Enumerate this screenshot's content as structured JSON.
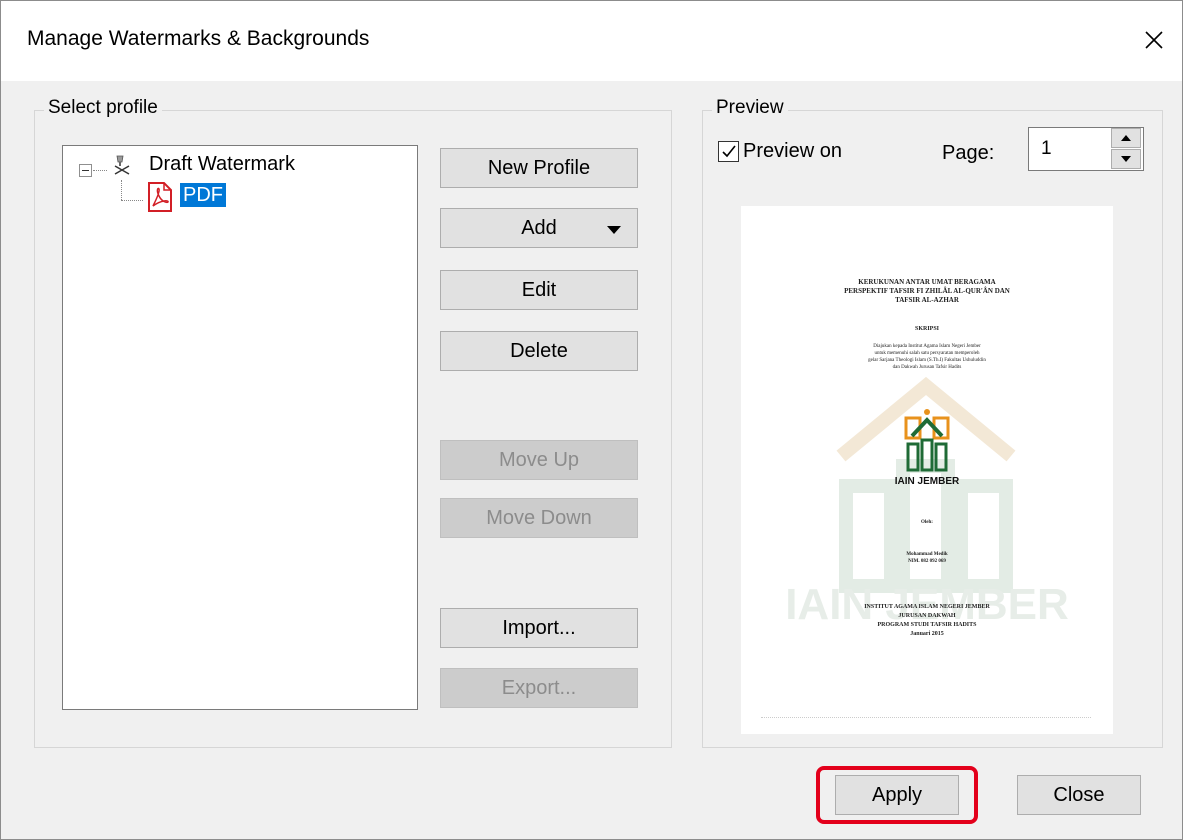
{
  "window": {
    "title": "Manage Watermarks & Backgrounds"
  },
  "select_profile": {
    "label": "Select profile",
    "tree": {
      "root_label": "Draft Watermark",
      "child_label": "PDF"
    },
    "buttons": {
      "new_profile": "New Profile",
      "add": "Add",
      "edit": "Edit",
      "delete": "Delete",
      "move_up": "Move Up",
      "move_down": "Move Down",
      "import": "Import...",
      "export": "Export..."
    }
  },
  "preview": {
    "label": "Preview",
    "preview_on_label": "Preview on",
    "preview_on_checked": true,
    "page_label": "Page:",
    "page_value": "1",
    "document": {
      "title_lines": [
        "KERUKUNAN ANTAR UMAT BERAGAMA",
        "PERSPEKTIF TAFSIR FI ZHILÂL AL-QUR'ÂN DAN",
        "TAFSIR AL-AZHAR"
      ],
      "type": "SKRIPSI",
      "description_lines": [
        "Diajukan kepada Institut Agama Islam Negeri Jember",
        "untuk memenuhi salah satu persyaratan memperoleh",
        "gelar Sarjana Theologi Islam (S.Th.I) Fakultas Ushuluddin",
        "dan Dakwah Jurusan Tafsir Hadits"
      ],
      "logo_caption": "IAIN JEMBER",
      "by": "Oleh:",
      "author": "Mohammad Medik",
      "nim": "NIM. 082 092 069",
      "institution_lines": [
        "INSTITUT AGAMA ISLAM NEGERI JEMBER",
        "JURUSAN DAKWAH",
        "PROGRAM STUDI TAFSIR HADITS"
      ],
      "date": "Januari 2015",
      "watermark_text": "IAIN JEMBER"
    }
  },
  "footer": {
    "apply": "Apply",
    "close": "Close"
  },
  "colors": {
    "selection": "#0078d7",
    "highlight": "#e3001b",
    "watermark_green": "#e7ede8",
    "logo_green": "#1f6b36",
    "logo_orange": "#e8921c"
  }
}
